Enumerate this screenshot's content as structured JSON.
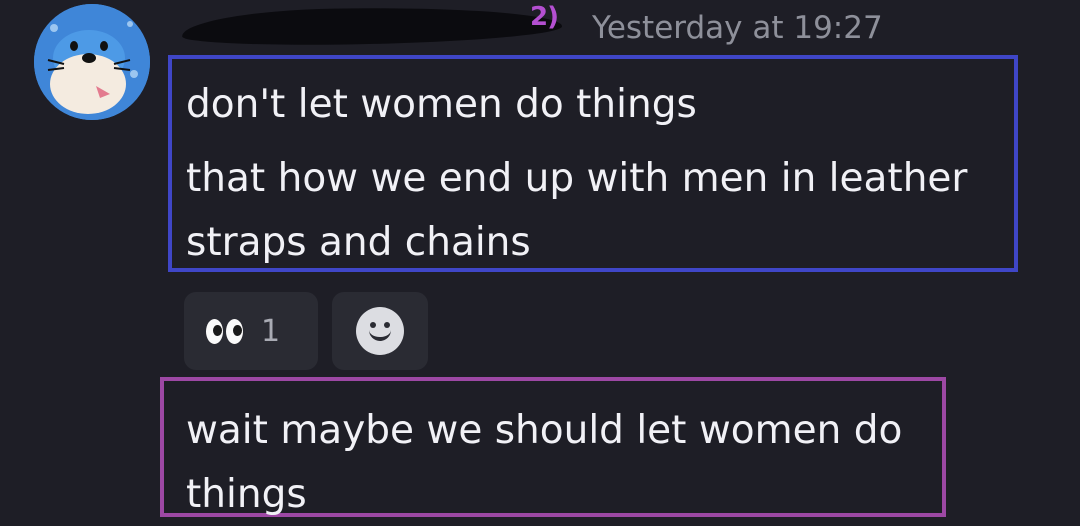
{
  "message": {
    "author": {
      "avatar": "seal-cartoon-avatar",
      "username_visible_fragment": "2)"
    },
    "timestamp": "Yesterday at 19:27",
    "lines": [
      "don't let women do things",
      "that how we end up with men in leather",
      "straps and chains"
    ],
    "reactions": [
      {
        "emoji": "eyes-emoji",
        "count": "1"
      }
    ],
    "add_reaction_icon": "smiley-add-reaction-icon"
  },
  "followup_message": {
    "lines": [
      "wait maybe we should let women do",
      "things"
    ]
  },
  "highlight_colors": {
    "first_message_box": "#3f46c7",
    "second_message_box": "#9d48a4"
  }
}
